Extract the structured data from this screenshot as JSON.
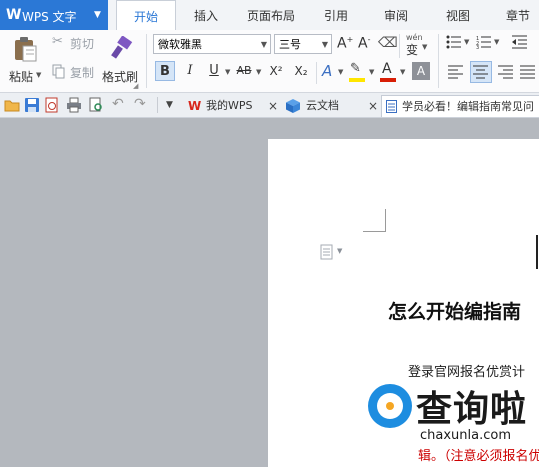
{
  "app": {
    "title": "WPS 文字",
    "logo": "W"
  },
  "menu": {
    "tabs": [
      "开始",
      "插入",
      "页面布局",
      "引用",
      "审阅",
      "视图",
      "章节"
    ],
    "active": "开始"
  },
  "ribbon": {
    "paste": "粘贴",
    "cut": "剪切",
    "copy": "复制",
    "format_painter": "格式刷",
    "font_name": "微软雅黑",
    "font_size": "三号",
    "bold": "B",
    "italic": "I",
    "underline": "U",
    "strike": "AB",
    "superscript": "X²",
    "subscript": "X₂",
    "font_color": "A",
    "pinyin": "变"
  },
  "doc_tabs": [
    {
      "label": "我的WPS",
      "icon": "wps-logo-icon"
    },
    {
      "label": "云文档",
      "icon": "cloud-cube-icon"
    },
    {
      "label": "学员必看！编辑指南常见问",
      "icon": "document-icon"
    }
  ],
  "document": {
    "heading": "怎么开始编指南",
    "line1": "登录官网报名优赏计",
    "line2": "辑。（注意必须报名优"
  },
  "watermark": {
    "text": "查询啦",
    "sub": "chaxunla.com"
  },
  "colors": {
    "accent": "#2b78d6",
    "font_color_bar": "#d81e06",
    "highlight_bar": "#ffe600",
    "watermark_blue": "#1d8de0"
  }
}
